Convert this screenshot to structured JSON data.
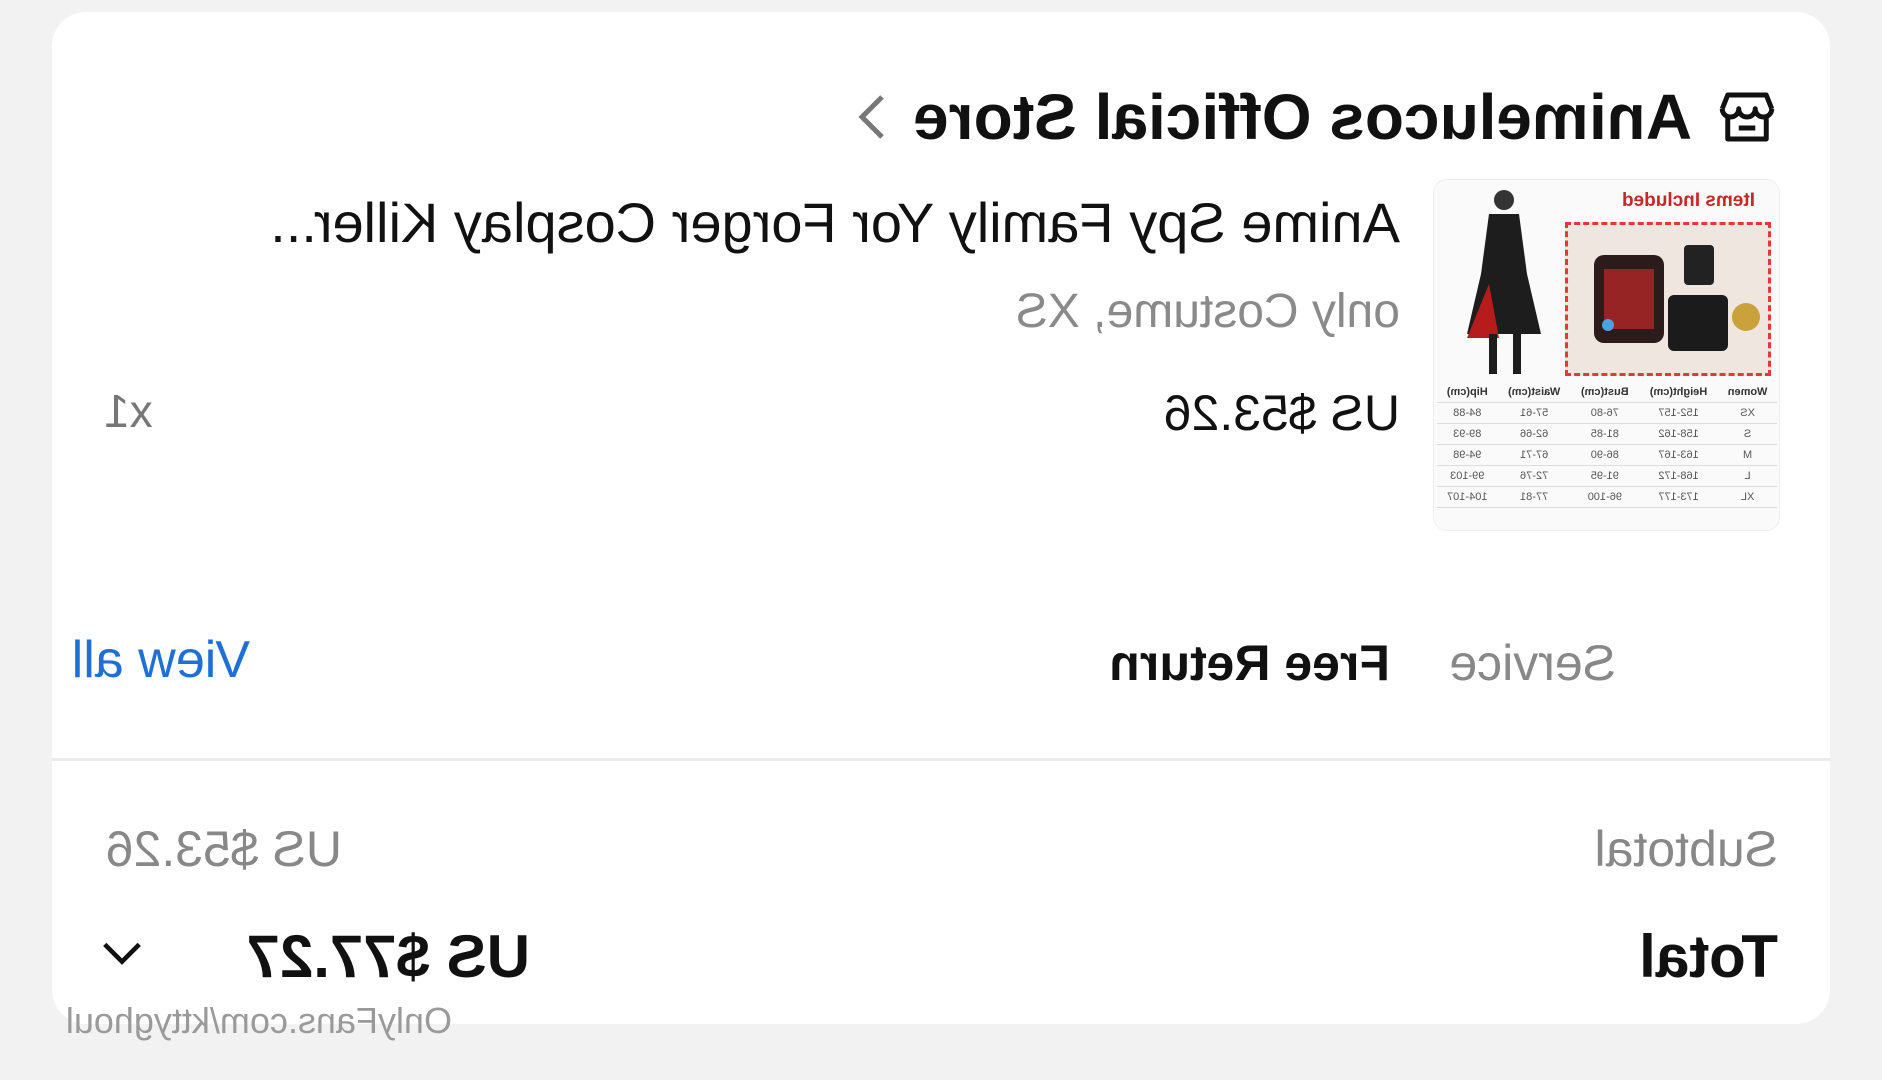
{
  "store": {
    "name": "Animelucos Official Store",
    "icon": "store-icon"
  },
  "product": {
    "title": "Anime Spy Family Yor Forger Cosplay Killer...",
    "variant": "only Costume, XS",
    "price": "US $53.26",
    "quantity": "x1",
    "image": {
      "header": "Items Included",
      "size_table": [
        [
          "Women",
          "Height(cm)",
          "Bust(cm)",
          "Waist(cm)",
          "Hip(cm)"
        ],
        [
          "XS",
          "152-157",
          "76-80",
          "57-61",
          "84-88"
        ],
        [
          "S",
          "158-162",
          "81-85",
          "62-66",
          "89-93"
        ],
        [
          "M",
          "163-167",
          "86-90",
          "67-71",
          "94-98"
        ],
        [
          "L",
          "168-172",
          "91-95",
          "72-76",
          "99-103"
        ],
        [
          "XL",
          "173-177",
          "96-100",
          "77-81",
          "104-107"
        ]
      ]
    }
  },
  "service": {
    "label": "Service",
    "value": "Free Return",
    "link": "View all"
  },
  "summary": {
    "subtotal_label": "Subtotal",
    "subtotal_value": "US $53.26",
    "total_label": "Total",
    "total_value": "US $77.27",
    "expand_icon": "chevron-down-icon"
  },
  "watermark": "OnlyFans.com/kttyghoul",
  "colors": {
    "link": "#1a73e8",
    "background": "#f2f2f2",
    "card": "#ffffff",
    "accent_red": "#c62828"
  }
}
